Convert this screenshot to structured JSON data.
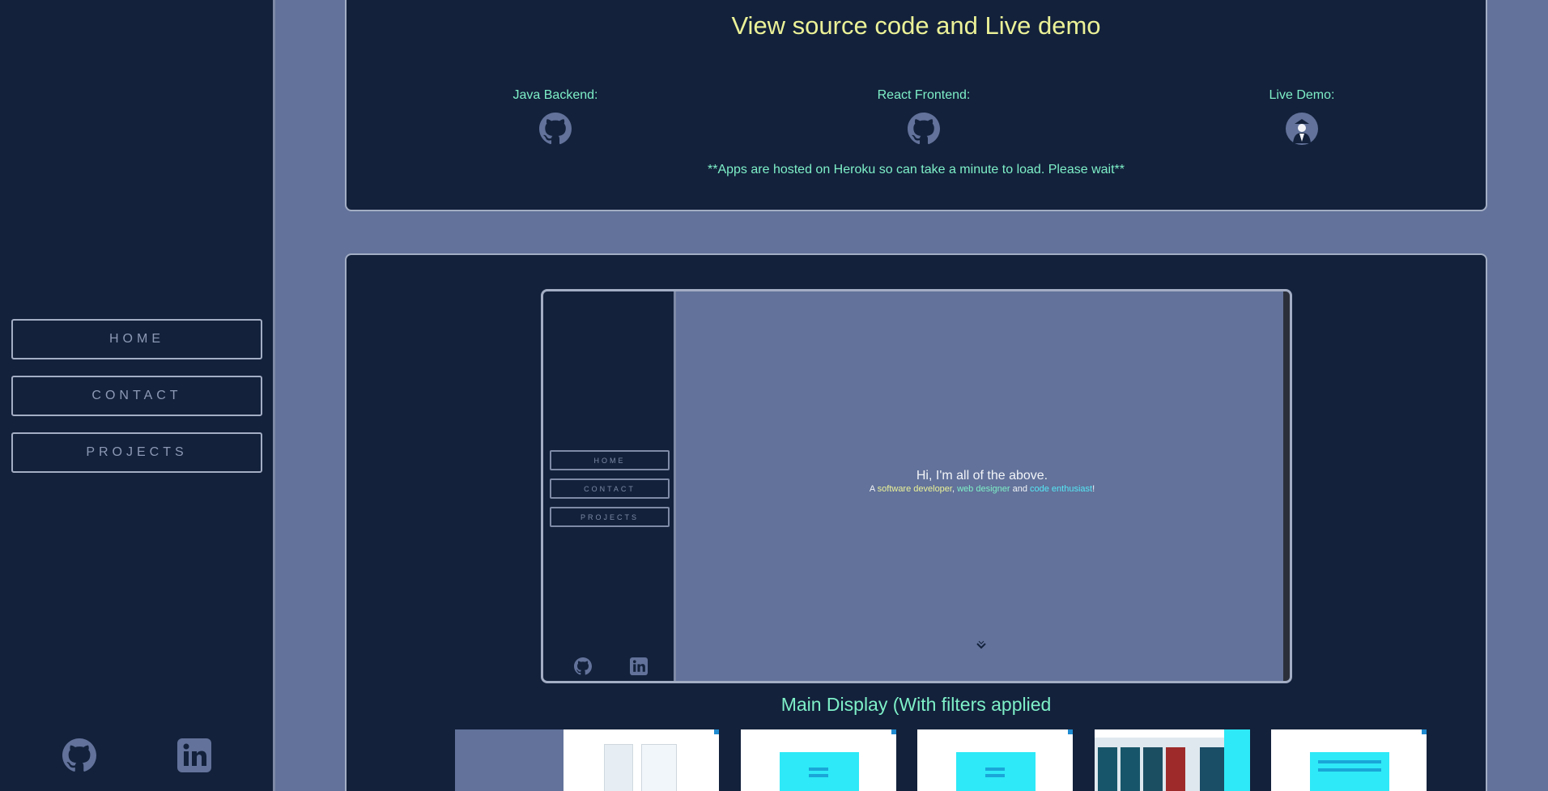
{
  "sidebar": {
    "nav": [
      {
        "label": "HOME"
      },
      {
        "label": "CONTACT"
      },
      {
        "label": "PROJECTS"
      }
    ],
    "social": [
      "github-icon",
      "linkedin-icon"
    ]
  },
  "links_panel": {
    "title": "View source code and Live demo",
    "columns": [
      {
        "label": "Java Backend:",
        "icon": "github-icon"
      },
      {
        "label": "React Frontend:",
        "icon": "github-icon"
      },
      {
        "label": "Live Demo:",
        "icon": "avatar-icon"
      }
    ],
    "note": "**Apps are hosted on Heroku so can take a minute to load. Please wait**"
  },
  "preview": {
    "nav": [
      "HOME",
      "CONTACT",
      "PROJECTS"
    ],
    "heading": "Hi, I'm all of the above.",
    "sub_prefix": "A ",
    "sub_a": "software developer",
    "sub_sep": ", ",
    "sub_b": "web designer",
    "sub_and": " and ",
    "sub_c": "code enthusiast",
    "sub_end": "!"
  },
  "caption": "Main Display (With filters applied",
  "colors": {
    "sidebar_bg": "#13213b",
    "page_bg": "#62729a",
    "title_yellow": "#ebf197",
    "accent_green": "#7ef0c8",
    "accent_cyan": "#2ee9f7"
  }
}
